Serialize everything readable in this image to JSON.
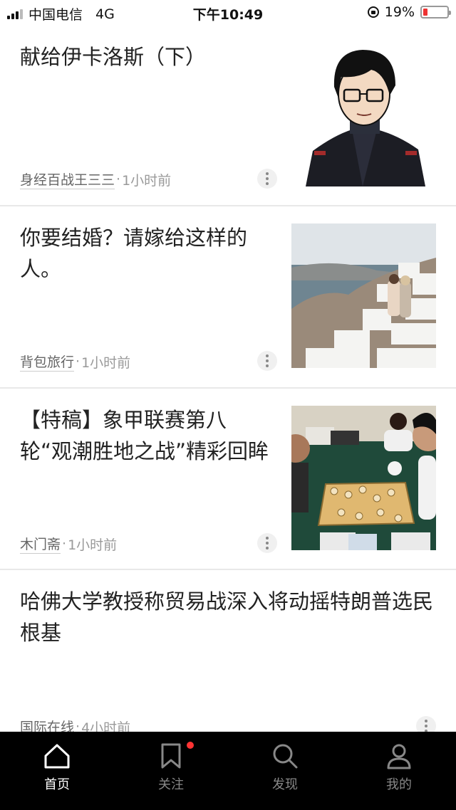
{
  "status_bar": {
    "carrier": "中国电信",
    "network": "4G",
    "time": "下午10:49",
    "battery": "19%",
    "battery_level": 0.19
  },
  "articles": [
    {
      "title": "献给伊卡洛斯（下）",
      "source": "身经百战王三三",
      "time": "1小时前",
      "thumbnail": "cartoon-man-glasses"
    },
    {
      "title": "你要结婚？请嫁给这样的人。",
      "source": "背包旅行",
      "time": "1小时前",
      "thumbnail": "santorini-couple-photo"
    },
    {
      "title": "【特稿】象甲联赛第八轮“观潮胜地之战”精彩回眸",
      "source": "木门斋",
      "time": "1小时前",
      "thumbnail": "chinese-chess-match-photo"
    },
    {
      "title": "哈佛大学教授称贸易战深入将动摇特朗普选民根基",
      "source": "国际在线",
      "time": "4小时前"
    }
  ],
  "tabs": [
    {
      "label": "首页",
      "icon": "home-icon",
      "active": true
    },
    {
      "label": "关注",
      "icon": "bookmark-icon",
      "active": false,
      "badge": true
    },
    {
      "label": "发现",
      "icon": "search-icon",
      "active": false
    },
    {
      "label": "我的",
      "icon": "profile-icon",
      "active": false
    }
  ],
  "colors": {
    "tab_bar": "#000000",
    "badge": "#ff3333",
    "battery_low": "#ee3333"
  }
}
